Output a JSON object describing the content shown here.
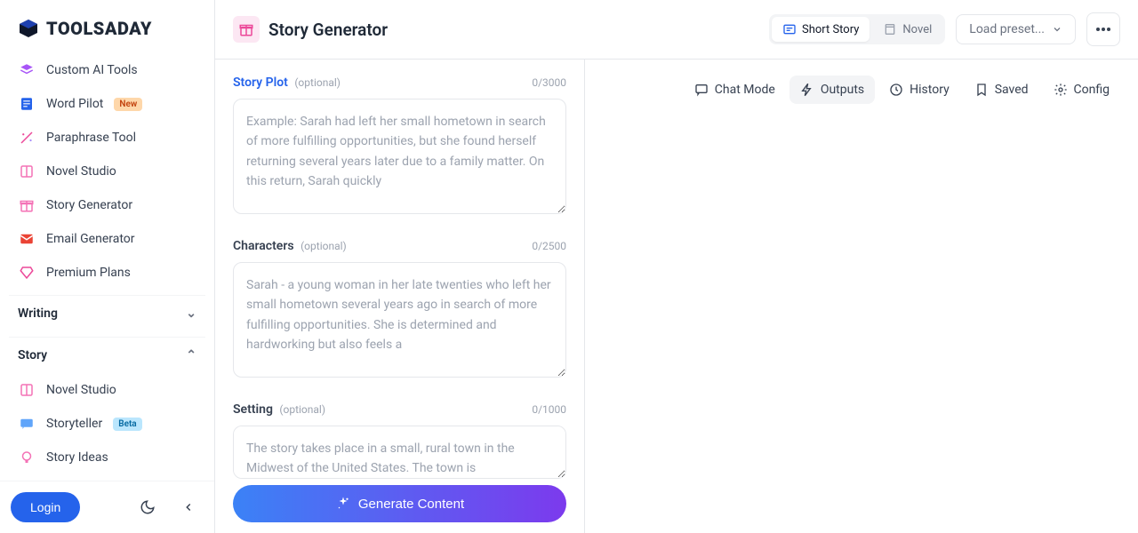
{
  "brand": "TOOLSADAY",
  "sidebar": {
    "items": [
      {
        "label": "Custom AI Tools"
      },
      {
        "label": "Word Pilot",
        "badge": "New"
      },
      {
        "label": "Paraphrase Tool"
      },
      {
        "label": "Novel Studio"
      },
      {
        "label": "Story Generator"
      },
      {
        "label": "Email Generator"
      },
      {
        "label": "Premium Plans"
      }
    ],
    "sections": {
      "writing": "Writing",
      "story": "Story"
    },
    "story_items": [
      {
        "label": "Novel Studio"
      },
      {
        "label": "Storyteller",
        "badge": "Beta"
      },
      {
        "label": "Story Ideas"
      }
    ],
    "login": "Login"
  },
  "header": {
    "title": "Story Generator",
    "seg": {
      "short": "Short Story",
      "novel": "Novel"
    },
    "preset": "Load preset..."
  },
  "form": {
    "plot": {
      "label": "Story Plot",
      "optional": "(optional)",
      "counter": "0/3000",
      "placeholder": "Example: Sarah had left her small hometown in search of more fulfilling opportunities, but she found herself returning several years later due to a family matter. On this return, Sarah quickly"
    },
    "characters": {
      "label": "Characters",
      "optional": "(optional)",
      "counter": "0/2500",
      "placeholder": "Sarah - a young woman in her late twenties who left her small hometown several years ago in search of more fulfilling opportunities. She is determined and hardworking but also feels a"
    },
    "setting": {
      "label": "Setting",
      "optional": "(optional)",
      "counter": "0/1000",
      "placeholder": "The story takes place in a small, rural town in the Midwest of the United States. The town is"
    },
    "generate": "Generate Content"
  },
  "tabs": {
    "chat": "Chat Mode",
    "outputs": "Outputs",
    "history": "History",
    "saved": "Saved",
    "config": "Config"
  }
}
